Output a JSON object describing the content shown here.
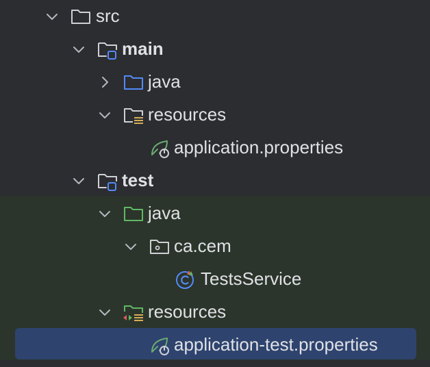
{
  "tree": {
    "items": [
      {
        "label": "src",
        "icon": "folder-icon",
        "expanded": true
      },
      {
        "label": "main",
        "icon": "module-folder-icon",
        "expanded": true
      },
      {
        "label": "java",
        "icon": "source-folder-icon",
        "expanded": false
      },
      {
        "label": "resources",
        "icon": "resources-folder-icon",
        "expanded": true
      },
      {
        "label": "application.properties",
        "icon": "spring-properties-icon"
      },
      {
        "label": "test",
        "icon": "module-folder-icon",
        "expanded": true
      },
      {
        "label": "java",
        "icon": "test-source-folder-icon",
        "expanded": true
      },
      {
        "label": "ca.cem",
        "icon": "package-icon",
        "expanded": true
      },
      {
        "label": "TestsService",
        "icon": "class-icon"
      },
      {
        "label": "resources",
        "icon": "test-resources-folder-icon",
        "expanded": true
      },
      {
        "label": "application-test.properties",
        "icon": "spring-properties-icon",
        "selected": true
      }
    ]
  },
  "colors": {
    "background": "#2b2d30",
    "test_background": "#2c352b",
    "selection": "#2e436e",
    "text": "#dfe1e5",
    "source_folder_blue": "#548af7",
    "test_folder_green": "#5fb865",
    "resources_yellow": "#d6ae58",
    "spring_green": "#6aab73"
  }
}
